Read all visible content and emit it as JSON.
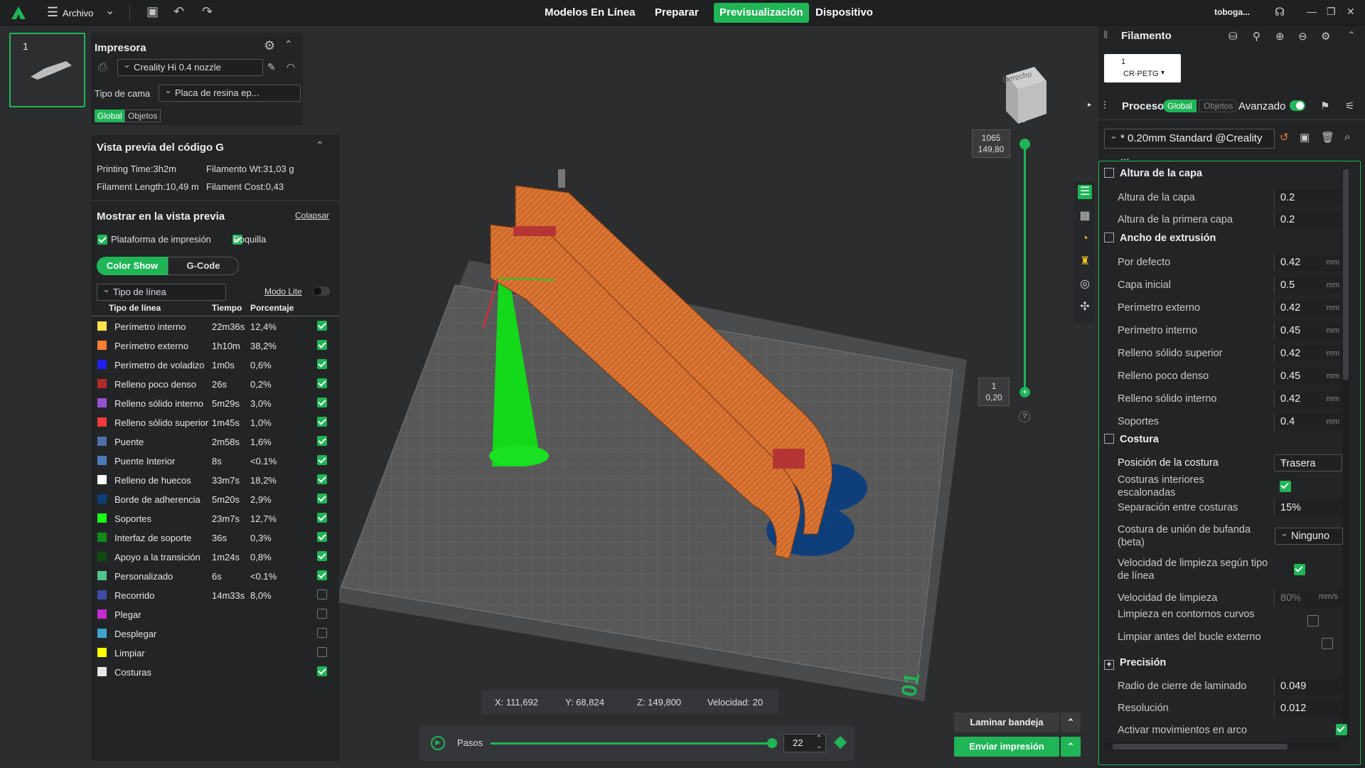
{
  "topbar": {
    "menu_label": "Archivo",
    "tabs": [
      "Modelos En Línea",
      "Preparar",
      "Previsualización",
      "Dispositivo"
    ],
    "active_tab": "Previsualización",
    "user": "toboga...",
    "colors": {
      "accent": "#20b557"
    }
  },
  "plate": {
    "number": "1"
  },
  "printer": {
    "title": "Impresora",
    "model": "Creality Hi 0.4 nozzle",
    "bed_label": "Tipo de cama",
    "bed_value": "Placa de resina ep...",
    "scope_global": "Global",
    "scope_objects": "Objetos"
  },
  "gcode": {
    "title": "Vista previa del código G",
    "printing_time": "Printing Time:3h2m",
    "filament_wt": "Filamento Wt:31,03 g",
    "filament_length": "Filament Length:10,49 m",
    "filament_cost": "Filament Cost:0,43"
  },
  "show": {
    "title": "Mostrar en la vista previa",
    "collapse": "Colapsar",
    "plataforma": "Plataforma de impresión",
    "boquilla": "Boquilla",
    "tab_color": "Color Show",
    "tab_gcode": "G-Code",
    "line_type_select": "Tipo de línea",
    "lite_mode": "Modo Lite",
    "col_type": "Tipo de línea",
    "col_time": "Tiempo",
    "col_pct": "Porcentaje"
  },
  "line_types": [
    {
      "name": "Perímetro interno",
      "time": "22m36s",
      "pct": "12,4%",
      "color": "#ffe14d",
      "checked": true
    },
    {
      "name": "Perímetro externo",
      "time": "1h10m",
      "pct": "38,2%",
      "color": "#ff7f32",
      "checked": true
    },
    {
      "name": "Perímetro de voladizo",
      "time": "1m0s",
      "pct": "0,6%",
      "color": "#1f1ff2",
      "checked": true
    },
    {
      "name": "Relleno poco denso",
      "time": "26s",
      "pct": "0,2%",
      "color": "#b22a2a",
      "checked": true
    },
    {
      "name": "Relleno sólido interno",
      "time": "5m29s",
      "pct": "3,0%",
      "color": "#9653d1",
      "checked": true
    },
    {
      "name": "Relleno sólido superior",
      "time": "1m45s",
      "pct": "1,0%",
      "color": "#f03a3a",
      "checked": true
    },
    {
      "name": "Puente",
      "time": "2m58s",
      "pct": "1,6%",
      "color": "#4e6ea8",
      "checked": true
    },
    {
      "name": "Puente Interior",
      "time": "8s",
      "pct": "<0.1%",
      "color": "#4d7bb8",
      "checked": true
    },
    {
      "name": "Relleno de huecos",
      "time": "33m7s",
      "pct": "18,2%",
      "color": "#ffffff",
      "checked": true
    },
    {
      "name": "Borde de adherencia",
      "time": "5m20s",
      "pct": "2,9%",
      "color": "#0f3f7a",
      "checked": true
    },
    {
      "name": "Soportes",
      "time": "23m7s",
      "pct": "12,7%",
      "color": "#19ff19",
      "checked": true
    },
    {
      "name": "Interfaz de soporte",
      "time": "36s",
      "pct": "0,3%",
      "color": "#0f8a1a",
      "checked": true
    },
    {
      "name": "Apoyo a la transición",
      "time": "1m24s",
      "pct": "0,8%",
      "color": "#0c4a12",
      "checked": true
    },
    {
      "name": "Personalizado",
      "time": "6s",
      "pct": "<0.1%",
      "color": "#4fc488",
      "checked": true
    },
    {
      "name": "Recorrido",
      "time": "14m33s",
      "pct": "8,0%",
      "color": "#3d4ea6",
      "checked": false
    },
    {
      "name": "Plegar",
      "time": "",
      "pct": "",
      "color": "#c22ccf",
      "checked": false
    },
    {
      "name": "Desplegar",
      "time": "",
      "pct": "",
      "color": "#3fa3cc",
      "checked": false
    },
    {
      "name": "Limpiar",
      "time": "",
      "pct": "",
      "color": "#ffff00",
      "checked": false
    },
    {
      "name": "Costuras",
      "time": "",
      "pct": "",
      "color": "#e6e6e6",
      "checked": true
    }
  ],
  "viewport": {
    "cube_label": "Derecho",
    "layer_top": "1065",
    "layer_top_h": "149,80",
    "layer_bottom": "1",
    "layer_bottom_h": "0,20",
    "help": "?",
    "coords": {
      "x": "X: 111,692",
      "y": "Y: 68,824",
      "z": "Z: 149,800",
      "speed": "Velocidad: 20"
    },
    "steps_label": "Pasos",
    "steps_value": "22",
    "slice_btn": "Laminar bandeja",
    "send_btn": "Enviar impresión",
    "plate_mark": "01"
  },
  "filament": {
    "title": "Filamento",
    "slot_number": "1",
    "slot_name": "CR-PETG"
  },
  "process": {
    "title": "Proceso",
    "scope_global": "Global",
    "scope_objects": "Objetos",
    "advanced": "Avanzado",
    "profile": "* 0.20mm Standard @Creality ..."
  },
  "settings": {
    "sec_layer": "Altura de la capa",
    "layer_height_label": "Altura de la capa",
    "layer_height": "0.2",
    "first_layer_label": "Altura de la primera capa",
    "first_layer": "0.2",
    "sec_width": "Ancho de extrusión",
    "widths": [
      {
        "label": "Por defecto",
        "value": "0.42"
      },
      {
        "label": "Capa inicial",
        "value": "0.5"
      },
      {
        "label": "Perímetro externo",
        "value": "0.42"
      },
      {
        "label": "Perímetro interno",
        "value": "0.45"
      },
      {
        "label": "Relleno sólido superior",
        "value": "0.42"
      },
      {
        "label": "Relleno poco denso",
        "value": "0.45"
      },
      {
        "label": "Relleno sólido interno",
        "value": "0.42"
      },
      {
        "label": "Soportes",
        "value": "0.4"
      }
    ],
    "unit_mm": "mm",
    "unit_mms": "mm/s",
    "sec_seam": "Costura",
    "seam_pos_label": "Posición de la costura",
    "seam_pos": "Trasera",
    "staggered_label": "Costuras interiores escalonadas",
    "seam_gap_label": "Separación entre costuras",
    "seam_gap": "15%",
    "scarf_label": "Costura de unión de bufanda (beta)",
    "scarf": "Ninguno",
    "wipe_speed_type_label": "Velocidad de limpieza según tipo de línea",
    "wipe_speed_label": "Velocidad de limpieza",
    "wipe_speed": "80%",
    "wipe_curved_label": "Limpieza en contornos curvos",
    "wipe_before_label": "Limpiar antes del bucle externo",
    "sec_precision": "Precisión",
    "slice_close_label": "Radio de cierre de laminado",
    "slice_close": "0.049",
    "resolution_label": "Resolución",
    "resolution": "0.012",
    "arc_label": "Activar movimientos en arco"
  }
}
